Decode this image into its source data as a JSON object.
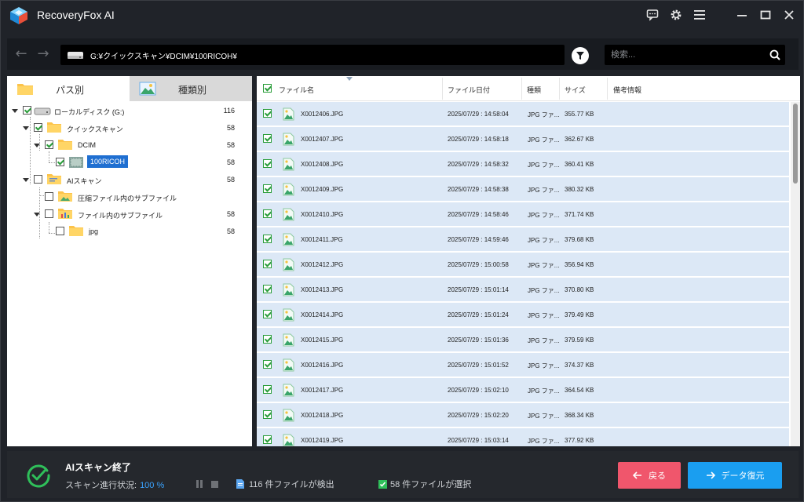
{
  "app": {
    "title": "RecoveryFox AI"
  },
  "titlebar": {
    "icons": [
      "feedback-icon",
      "gear-icon",
      "menu-icon",
      "minimize-icon",
      "maximize-icon",
      "close-icon"
    ]
  },
  "nav": {
    "path": "G:¥クイックスキャン¥DCIM¥100RICOH¥",
    "search_placeholder": "検索..."
  },
  "left": {
    "tabs": [
      {
        "label": "パス別",
        "active": true
      },
      {
        "label": "種類別",
        "active": false
      }
    ],
    "tree": [
      {
        "label": "ローカルディスク (G:)",
        "count": "116",
        "checked": true
      },
      {
        "label": "クイックスキャン",
        "count": "58",
        "checked": true
      },
      {
        "label": "DCIM",
        "count": "58",
        "checked": true
      },
      {
        "label": "100RICOH",
        "count": "58",
        "checked": true,
        "selected": true
      },
      {
        "label": "AIスキャン",
        "count": "58",
        "checked": false
      },
      {
        "label": "圧縮ファイル内のサブファイル",
        "count": "",
        "checked": false
      },
      {
        "label": "ファイル内のサブファイル",
        "count": "58",
        "checked": false
      },
      {
        "label": "jpg",
        "count": "58",
        "checked": false
      }
    ]
  },
  "table": {
    "headers": {
      "name": "ファイル名",
      "date": "ファイル日付",
      "type": "種類",
      "size": "サイズ",
      "note": "備考情報"
    },
    "rows": [
      {
        "name": "X0012406.JPG",
        "date": "2025/07/29 : 14:58:04",
        "type": "JPG ファ...",
        "size": "355.77 KB"
      },
      {
        "name": "X0012407.JPG",
        "date": "2025/07/29 : 14:58:18",
        "type": "JPG ファ...",
        "size": "362.67 KB"
      },
      {
        "name": "X0012408.JPG",
        "date": "2025/07/29 : 14:58:32",
        "type": "JPG ファ...",
        "size": "360.41 KB"
      },
      {
        "name": "X0012409.JPG",
        "date": "2025/07/29 : 14:58:38",
        "type": "JPG ファ...",
        "size": "380.32 KB"
      },
      {
        "name": "X0012410.JPG",
        "date": "2025/07/29 : 14:58:46",
        "type": "JPG ファ...",
        "size": "371.74 KB"
      },
      {
        "name": "X0012411.JPG",
        "date": "2025/07/29 : 14:59:46",
        "type": "JPG ファ...",
        "size": "379.68 KB"
      },
      {
        "name": "X0012412.JPG",
        "date": "2025/07/29 : 15:00:58",
        "type": "JPG ファ...",
        "size": "356.94 KB"
      },
      {
        "name": "X0012413.JPG",
        "date": "2025/07/29 : 15:01:14",
        "type": "JPG ファ...",
        "size": "370.80 KB"
      },
      {
        "name": "X0012414.JPG",
        "date": "2025/07/29 : 15:01:24",
        "type": "JPG ファ...",
        "size": "379.49 KB"
      },
      {
        "name": "X0012415.JPG",
        "date": "2025/07/29 : 15:01:36",
        "type": "JPG ファ...",
        "size": "379.59 KB"
      },
      {
        "name": "X0012416.JPG",
        "date": "2025/07/29 : 15:01:52",
        "type": "JPG ファ...",
        "size": "374.37 KB"
      },
      {
        "name": "X0012417.JPG",
        "date": "2025/07/29 : 15:02:10",
        "type": "JPG ファ...",
        "size": "364.54 KB"
      },
      {
        "name": "X0012418.JPG",
        "date": "2025/07/29 : 15:02:20",
        "type": "JPG ファ...",
        "size": "368.34 KB"
      },
      {
        "name": "X0012419.JPG",
        "date": "2025/07/29 : 15:03:14",
        "type": "JPG ファ...",
        "size": "377.92 KB"
      }
    ]
  },
  "bottom": {
    "title": "AIスキャン終了",
    "status_label": "スキャン進行状況:",
    "progress": "100 %",
    "found": "116 件ファイルが検出",
    "selected": "58 件ファイルが選択",
    "back_label": "戻る",
    "recover_label": "データ復元"
  },
  "colors": {
    "accent": "#1a9ef0",
    "back": "#f0566c",
    "row_selected": "#dce8f6",
    "check": "#2a9d3a"
  }
}
